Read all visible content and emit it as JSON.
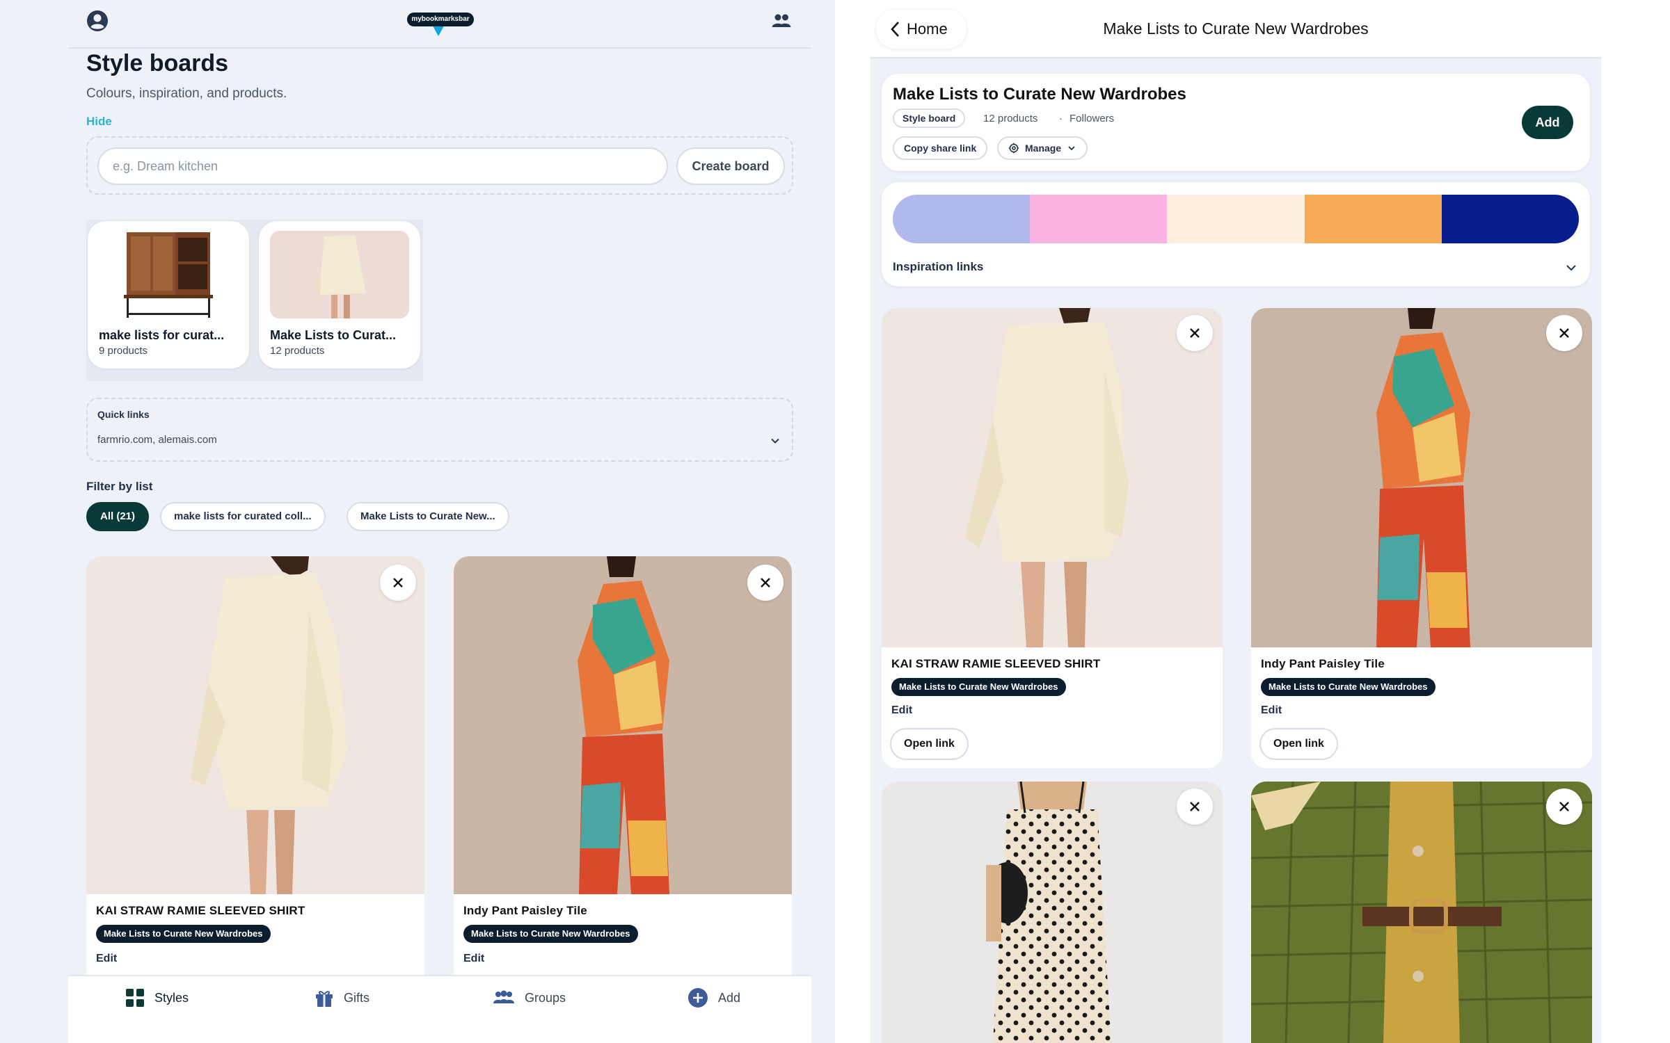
{
  "left": {
    "title": "Style boards",
    "subtitle": "Colours, inspiration, and products.",
    "hide_label": "Hide",
    "create": {
      "placeholder": "e.g. Dream kitchen",
      "button": "Create board"
    },
    "boards": [
      {
        "name": "make lists for curat...",
        "count": "9 products"
      },
      {
        "name": "Make Lists to Curat...",
        "count": "12 products"
      }
    ],
    "quick_links": {
      "title": "Quick links",
      "value": "farmrio.com, alemais.com"
    },
    "filter": {
      "title": "Filter by list",
      "chips": [
        "All (21)",
        "make lists for curated coll...",
        "Make Lists to Curate New..."
      ]
    },
    "products": [
      {
        "title": "KAI STRAW RAMIE SLEEVED SHIRT",
        "tag": "Make Lists to Curate New Wardrobes",
        "edit": "Edit"
      },
      {
        "title": "Indy Pant Paisley Tile",
        "tag": "Make Lists to Curate New Wardrobes",
        "edit": "Edit"
      }
    ],
    "nav": [
      "Styles",
      "Gifts",
      "Groups",
      "Add"
    ]
  },
  "right": {
    "home_label": "Home",
    "header_title": "Make Lists to Curate New Wardrobes",
    "board": {
      "title": "Make Lists to Curate New Wardrobes",
      "badge": "Style board",
      "products": "12 products",
      "separator": "·",
      "followers": "Followers",
      "copy_link": "Copy share link",
      "manage": "Manage",
      "add": "Add"
    },
    "palette": [
      "#b1b8ee",
      "#f9b3e0",
      "#fcefdc",
      "#f7ab56",
      "#071d8c"
    ],
    "inspiration_label": "Inspiration links",
    "products": [
      {
        "title": "KAI STRAW RAMIE SLEEVED SHIRT",
        "tag": "Make Lists to Curate New Wardrobes",
        "edit": "Edit",
        "open": "Open link"
      },
      {
        "title": "Indy Pant Paisley Tile",
        "tag": "Make Lists to Curate New Wardrobes",
        "edit": "Edit",
        "open": "Open link"
      }
    ]
  },
  "colors": {
    "accent": "#0a3a36",
    "navy": "#0c1d2e",
    "link": "#2bb3cf"
  },
  "icons": [
    "user-circle-icon",
    "groups-icon",
    "chevron-down-icon",
    "close-icon",
    "chevron-left-icon",
    "gear-icon",
    "styles-grid-icon",
    "gift-icon",
    "plus-circle-icon"
  ]
}
